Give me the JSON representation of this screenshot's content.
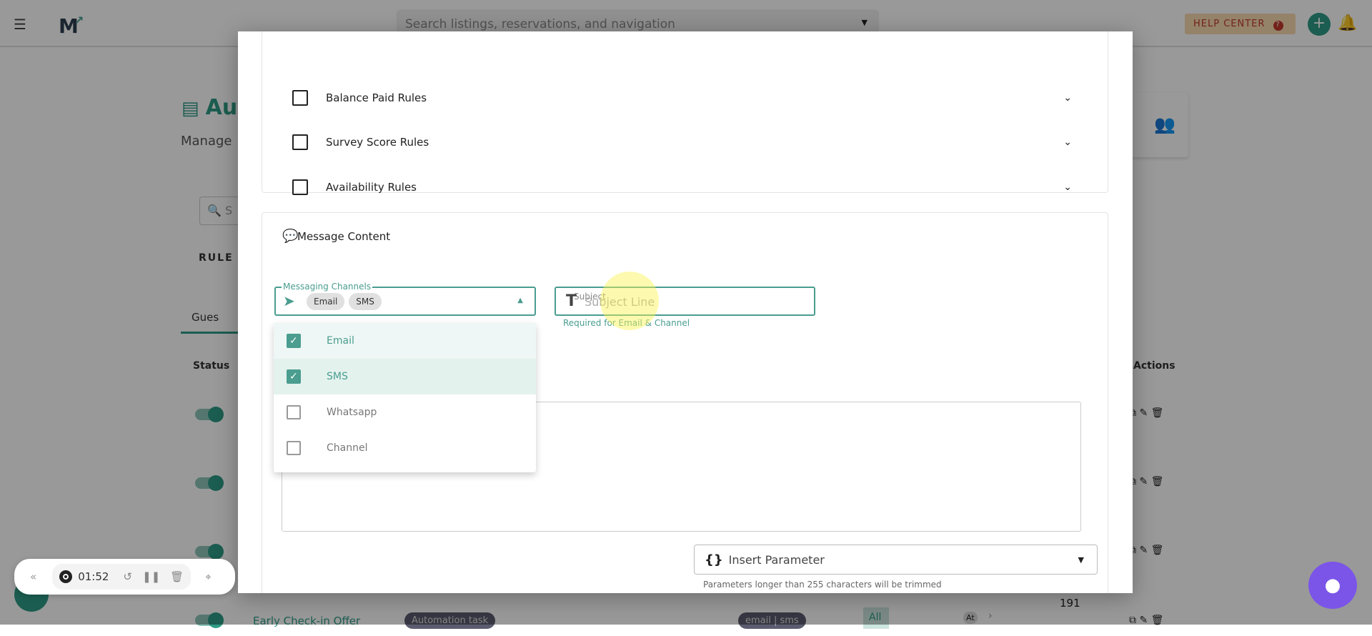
{
  "topbar": {
    "search_placeholder": "Search listings, reservations, and navigation",
    "help_center": "HELP CENTER"
  },
  "background": {
    "page_title": "Au",
    "page_subtitle": "Manage",
    "search_placeholder": "S",
    "rule_tabs_label": "RULE T",
    "tab_label": "Gues",
    "table_headers": {
      "status": "Status",
      "actions": "Actions"
    },
    "last_row": {
      "name": "Early Check-in Offer",
      "type": "Automation task",
      "channels": "email | sms",
      "audience": "All",
      "at": "At",
      "count": "191"
    }
  },
  "modal": {
    "rules": [
      {
        "label": "Balance Paid Rules",
        "checked": false
      },
      {
        "label": "Survey Score Rules",
        "checked": false
      },
      {
        "label": "Availability Rules",
        "checked": false
      }
    ],
    "message_content": {
      "title": "Message Content",
      "channels": {
        "label": "Messaging Channels",
        "selected": [
          "Email",
          "SMS"
        ],
        "options": [
          {
            "label": "Email",
            "checked": true
          },
          {
            "label": "SMS",
            "checked": true
          },
          {
            "label": "Whatsapp",
            "checked": false
          },
          {
            "label": "Channel",
            "checked": false
          }
        ]
      },
      "subject": {
        "label": "Subject",
        "placeholder": "Subject Line",
        "helper": "Required for Email & Channel"
      },
      "insert_parameter": {
        "label": "Insert Parameter",
        "helper": "Parameters longer than 255 characters will be trimmed"
      }
    }
  },
  "recorder": {
    "time": "01:52"
  },
  "colors": {
    "accent": "#4a9d8f",
    "chat": "#7b55e8"
  }
}
